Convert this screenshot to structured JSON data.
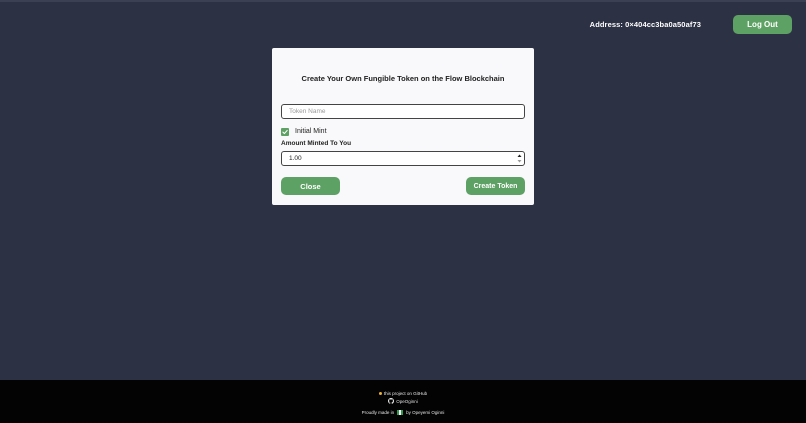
{
  "header": {
    "address_text": "Address: 0×404cc3ba0a50af73",
    "logout_label": "Log Out"
  },
  "modal": {
    "title": "Create Your Own Fungible Token on the Flow Blockchain",
    "token_name_placeholder": "Token Name",
    "token_name_value": "",
    "initial_mint_label": "Initial Mint",
    "initial_mint_checked": true,
    "amount_label": "Amount Minted To You",
    "amount_value": "1.00",
    "close_label": "Close",
    "create_label": "Create Token"
  },
  "footer": {
    "github_text": "this project on GitHub",
    "github_user": "OpeOginni",
    "made_in_prefix": "Proudly made in",
    "made_in_suffix": "by Opeyemi Oginni"
  },
  "colors": {
    "background": "#2c3144",
    "accent_green": "#5ea164",
    "modal_bg": "#f9f9fb",
    "footer_bg": "#030303"
  },
  "icons": {
    "github": "github-icon",
    "star": "star-icon",
    "flag": "nigeria-flag-icon",
    "check": "check-icon"
  }
}
